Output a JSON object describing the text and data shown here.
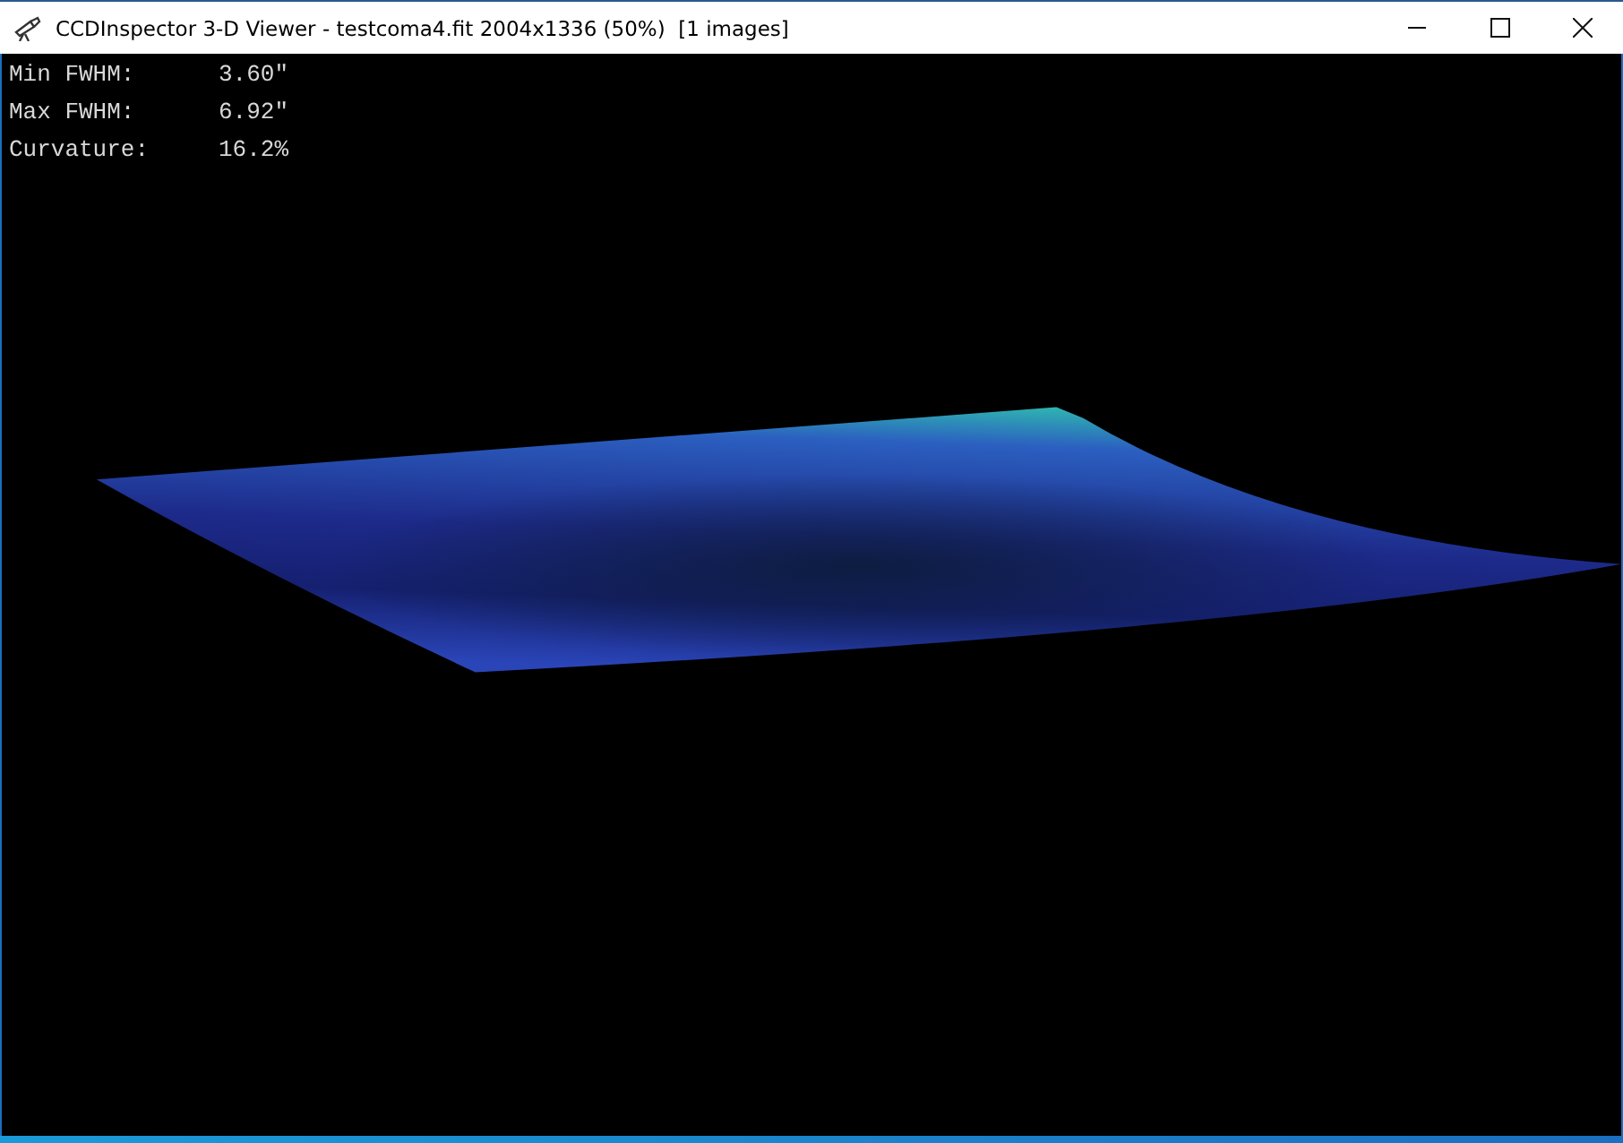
{
  "window": {
    "title": "CCDInspector 3-D Viewer - testcoma4.fit 2004x1336 (50%)  [1 images]"
  },
  "stats": [
    {
      "label": "Min FWHM:",
      "value": "3.60\""
    },
    {
      "label": "Max FWHM:",
      "value": "6.92\""
    },
    {
      "label": "Curvature:",
      "value": "16.2%"
    }
  ]
}
